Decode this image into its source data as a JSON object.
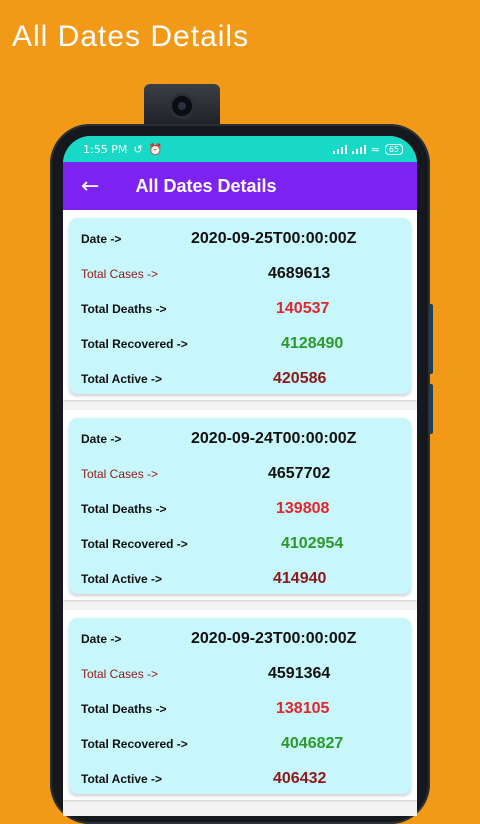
{
  "promo": {
    "title": "All Dates Details"
  },
  "status": {
    "time": "1:55 PM",
    "battery": "65"
  },
  "appbar": {
    "back_icon": "←",
    "title": "All Dates Details"
  },
  "labels": {
    "date": "Date ->",
    "cases": "Total Cases ->",
    "deaths": "Total Deaths ->",
    "recovered": "Total Recovered ->",
    "active": "Total Active ->"
  },
  "entries": [
    {
      "date": "2020-09-25T00:00:00Z",
      "cases": "4689613",
      "deaths": "140537",
      "recovered": "4128490",
      "active": "420586"
    },
    {
      "date": "2020-09-24T00:00:00Z",
      "cases": "4657702",
      "deaths": "139808",
      "recovered": "4102954",
      "active": "414940"
    },
    {
      "date": "2020-09-23T00:00:00Z",
      "cases": "4591364",
      "deaths": "138105",
      "recovered": "4046827",
      "active": "406432"
    }
  ],
  "colors": {
    "background": "#f29a17",
    "statusbar": "#18d8c6",
    "appbar": "#7c22f2",
    "card": "#c8f7fb",
    "deaths": "#e1252c",
    "recovered": "#2b9a2b",
    "active": "#8c1a1a"
  }
}
